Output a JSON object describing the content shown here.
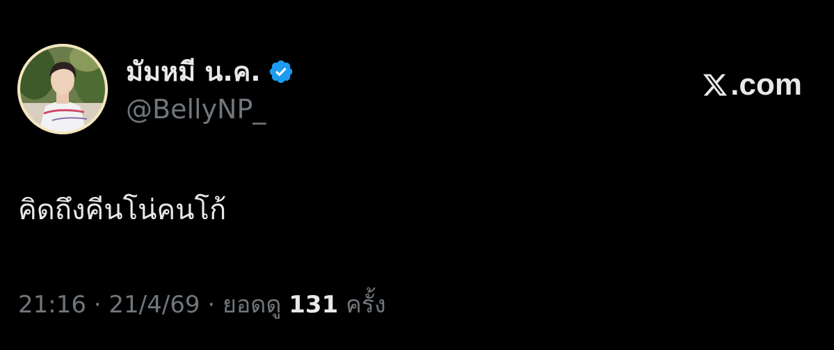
{
  "tweet": {
    "author": {
      "display_name": "มัมหมี น.ค.",
      "handle": "@BellyNP_",
      "verified": true,
      "avatar_icon": "profile-photo"
    },
    "text": "คิดถึงคีนโน่คนโก้",
    "time": "21:16",
    "separator": "·",
    "date": "21/4/69",
    "views_label": "ยอดดู",
    "views_count": "131",
    "views_unit": "ครั้ง"
  },
  "brand": {
    "domain": ".com",
    "icon": "x-logo-icon"
  },
  "colors": {
    "background": "#000000",
    "primary_text": "#e7e9ea",
    "secondary_text": "#71767b",
    "verified_blue": "#1d9bf0"
  }
}
